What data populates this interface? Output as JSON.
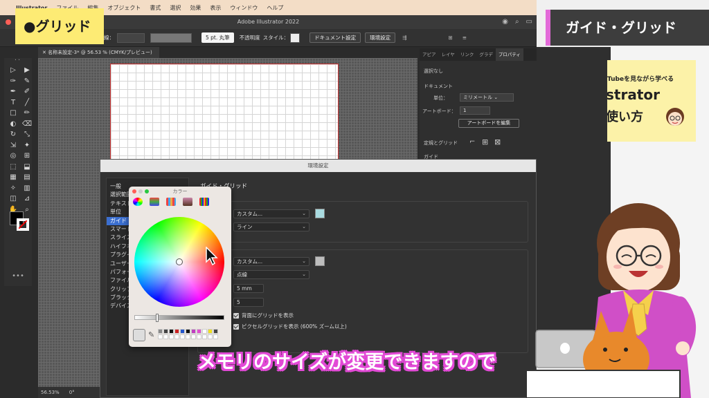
{
  "overlay": {
    "chapter_label": "●グリッド",
    "section_banner": "ガイド・グリッド",
    "subtitle": "メモリのサイズが変更できますので",
    "promo_line1": "Tubeを見ながら学べる",
    "promo_line2": "strator",
    "promo_line3": "使い方"
  },
  "menubar": {
    "apple": "",
    "items": [
      "Illustrator",
      "ファイル",
      "編集",
      "オブジェクト",
      "書式",
      "選択",
      "効果",
      "表示",
      "ウィンドウ",
      "ヘルプ"
    ]
  },
  "window": {
    "title": "Adobe Illustrator 2022"
  },
  "control_bar": {
    "stroke_label": "線：",
    "brush_value": "5 pt. 丸筆",
    "opacity_label": "不透明度",
    "style_label": "スタイル：",
    "doc_settings_button": "ドキュメント設定",
    "prefs_button": "環境設定"
  },
  "document": {
    "tab_label": "名称未設定-3* @ 56.53 % (CMYK/プレビュー)",
    "zoom": "56.53%",
    "rotation": "0°"
  },
  "tools": [
    "▷",
    "▶",
    "✑",
    "✎",
    "✒",
    "✐",
    "T",
    "╱",
    "□",
    "✏",
    "◐",
    "⌫",
    "↻",
    "⤡",
    "⇲",
    "✦",
    "◎",
    "⊞",
    "⬚",
    "⬓",
    "▦",
    "▤",
    "✧",
    "▥",
    "◫",
    "⊿",
    "✋",
    "⌕"
  ],
  "properties_panel": {
    "tabs": [
      "アピア",
      "レイヤ",
      "リンク",
      "グラデ",
      "プロパティ"
    ],
    "active_tab": "プロパティ",
    "selection": "選択なし",
    "document_header": "ドキュメント",
    "units_label": "単位：",
    "units_value": "ミリメートル",
    "artboard_label": "アートボード：",
    "artboard_value": "1",
    "edit_artboard_button": "アートボードを編集",
    "rulers_grids_label": "定規とグリッド",
    "guides_label": "ガイド"
  },
  "prefs_dialog": {
    "title": "環境設定",
    "categories": [
      "一般",
      "選択範囲",
      "テキスト",
      "単位",
      "ガイド",
      "スマート",
      "スライス",
      "ハイフネ",
      "プラグイ",
      "ユーザー",
      "パフォー",
      "ファイル",
      "クリップ",
      "ブラック",
      "デバイス"
    ],
    "selected_category": "ガイド",
    "heading": "ガイド・グリッド",
    "guide_color": "カスタム...",
    "guide_style": "ライン",
    "guide_swatch_color": "#a9dbe0",
    "grid_color": "カスタム...",
    "grid_style": "点線",
    "grid_swatch_color": "#bdbdbd",
    "gridline_every": "5 mm",
    "subdivisions": "5",
    "grids_in_back": "背面にグリッドを表示",
    "show_pixel_grid": "ピクセルグリッドを表示 (600% ズーム以上)"
  },
  "color_picker": {
    "title": "カラー",
    "modes": [
      "color-wheel",
      "sliders",
      "palettes",
      "image-palettes",
      "pencils"
    ],
    "swatches": [
      "#888888",
      "#444444",
      "#111111",
      "#cc2222",
      "#2255cc",
      "#111111",
      "#c040c0",
      "#e050d0",
      "#ffffff",
      "#f0e020",
      "#444444",
      "#ffffff",
      "#ffffff",
      "#ffffff",
      "#ffffff",
      "#ffffff",
      "#ffffff",
      "#ffffff",
      "#ffffff",
      "#ffffff",
      "#ffffff",
      "#ffffff"
    ]
  }
}
